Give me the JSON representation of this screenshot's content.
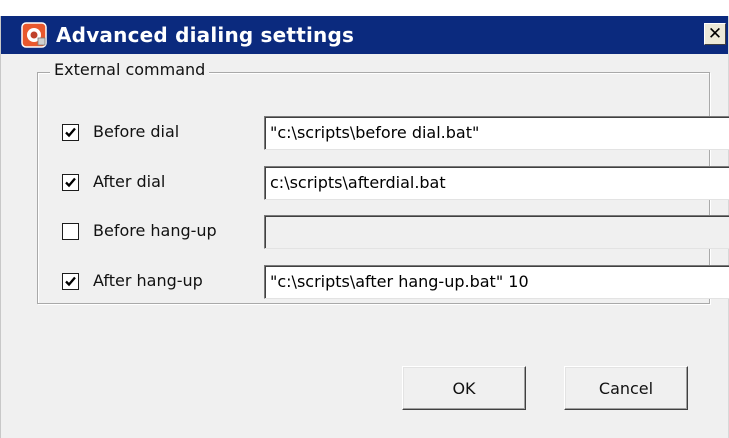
{
  "window": {
    "title": "Advanced dialing settings",
    "close_glyph": "✕",
    "icon": "app-icon",
    "titlebar_color": "#0b2a7e"
  },
  "group": {
    "legend": "External command"
  },
  "rows": [
    {
      "label": "Before dial",
      "checked": true,
      "value": "\"c:\\scripts\\before dial.bat\"",
      "enabled": true
    },
    {
      "label": "After dial",
      "checked": true,
      "value": "c:\\scripts\\afterdial.bat",
      "enabled": true
    },
    {
      "label": "Before hang-up",
      "checked": false,
      "value": "",
      "enabled": false
    },
    {
      "label": "After hang-up",
      "checked": true,
      "value": "\"c:\\scripts\\after hang-up.bat\" 10",
      "enabled": true
    }
  ],
  "buttons": {
    "ok": "OK",
    "cancel": "Cancel"
  }
}
